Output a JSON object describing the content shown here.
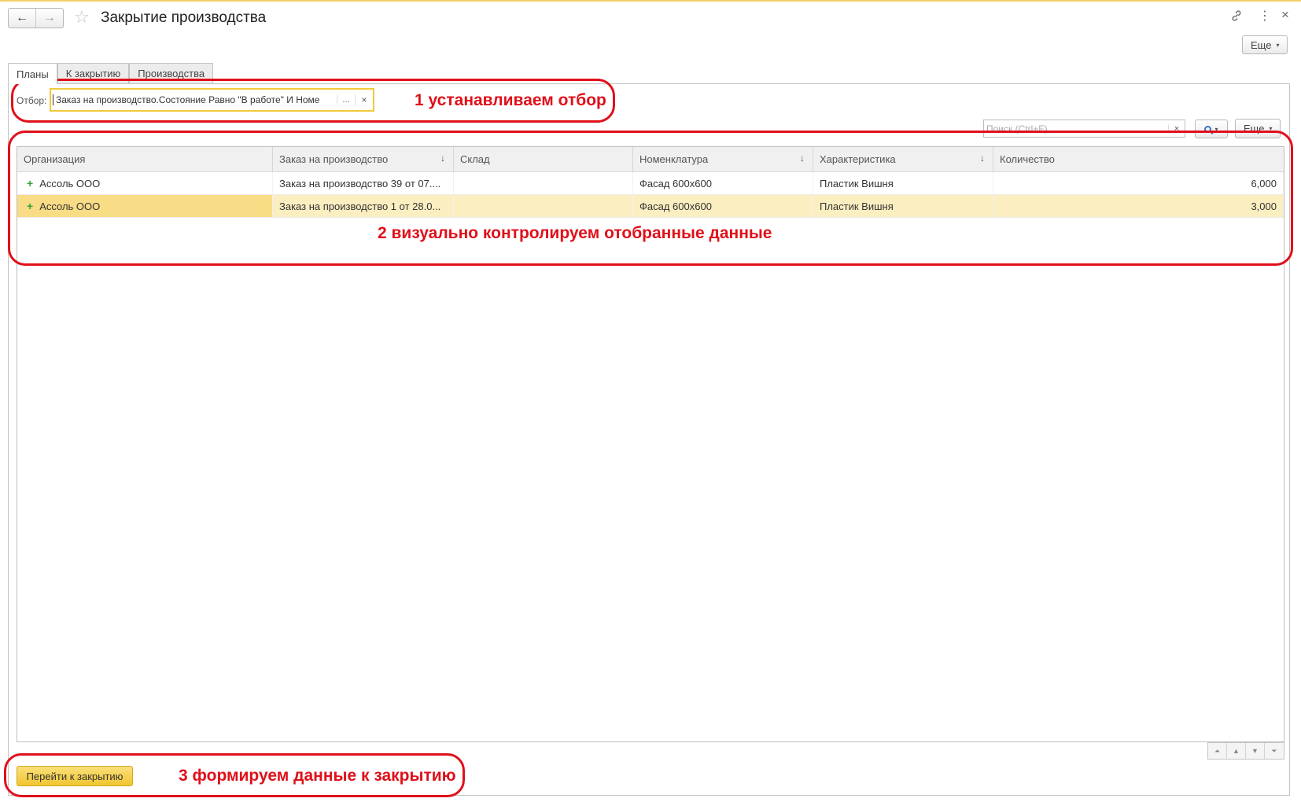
{
  "header": {
    "title": "Закрытие производства",
    "back_icon": "←",
    "forward_icon": "→",
    "star_icon": "☆",
    "link_icon": "🔗",
    "kebab_icon": "⋮",
    "close_icon": "×",
    "more_label": "Еще",
    "caret": "▾"
  },
  "tabs": [
    {
      "label": "Планы"
    },
    {
      "label": "К закрытию"
    },
    {
      "label": "Производства"
    }
  ],
  "filter": {
    "label": "Отбор:",
    "value": "Заказ на производство.Состояние Равно \"В работе\" И Номе",
    "dots": "...",
    "clear": "×"
  },
  "search": {
    "placeholder": "Поиск (Ctrl+F)",
    "clear": "×",
    "more_label": "Еще",
    "caret": "▾"
  },
  "table": {
    "columns": [
      {
        "label": "Организация",
        "sort": ""
      },
      {
        "label": "Заказ на производство",
        "sort": "↓"
      },
      {
        "label": "Склад",
        "sort": ""
      },
      {
        "label": "Номенклатура",
        "sort": "↓"
      },
      {
        "label": "Характеристика",
        "sort": "↓"
      },
      {
        "label": "Количество",
        "sort": ""
      }
    ],
    "rows": [
      {
        "marker": "+",
        "org": "Ассоль ООО",
        "order": "Заказ на производство 39 от 07....",
        "warehouse": "",
        "item": "Фасад 600x600",
        "characteristic": "Пластик Вишня",
        "qty": "6,000"
      },
      {
        "marker": "+",
        "org": "Ассоль ООО",
        "order": "Заказ на производство 1 от 28.0...",
        "warehouse": "",
        "item": "Фасад 600x600",
        "characteristic": "Пластик Вишня",
        "qty": "3,000"
      }
    ],
    "selected_row": 1
  },
  "scroll_buttons": [
    "⏶",
    "▲",
    "▼",
    "⏷"
  ],
  "footer": {
    "go_button": "Перейти к закрытию"
  },
  "annotations": {
    "a1": "1 устанавливаем отбор",
    "a2": "2 визуально контролируем отобранные данные",
    "a3": "3 формируем данные к закрытию",
    "color": "#e0101a"
  }
}
